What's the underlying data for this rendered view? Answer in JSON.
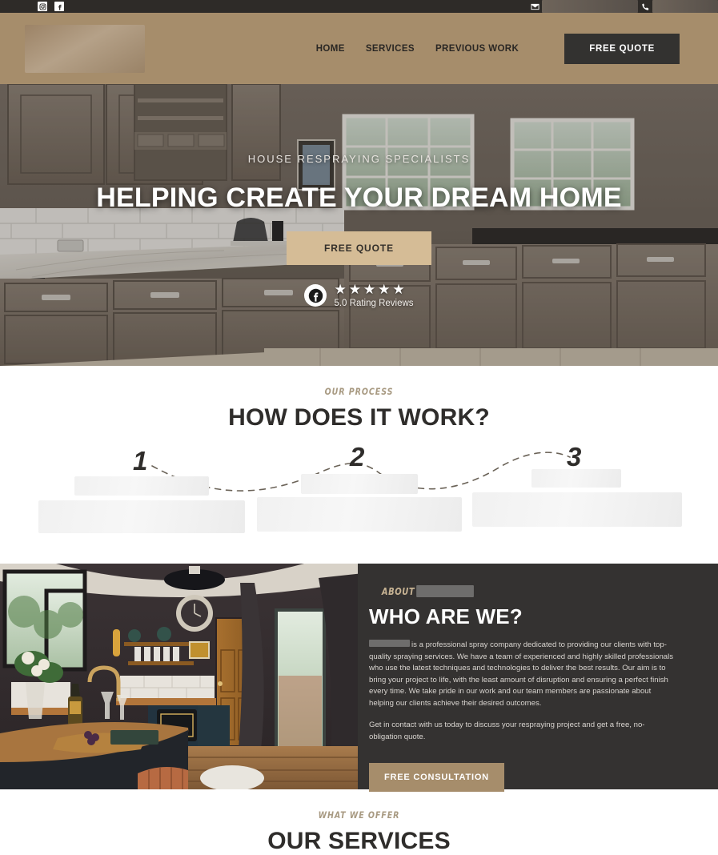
{
  "topbar": {
    "social": [
      {
        "name": "instagram-icon",
        "label": "Instagram"
      },
      {
        "name": "facebook-icon",
        "label": "Facebook"
      }
    ],
    "email_icon": "envelope-icon",
    "email_value": "",
    "phone_icon": "phone-icon",
    "phone_value": "",
    "bg": "#2e2b28"
  },
  "header": {
    "logo_alt": "",
    "nav": [
      {
        "label": "HOME"
      },
      {
        "label": "SERVICES"
      },
      {
        "label": "PREVIOUS WORK"
      }
    ],
    "cta_label": "FREE QUOTE",
    "bg": "#a68d6b",
    "cta_bg": "#333230"
  },
  "hero": {
    "kicker": "HOUSE RESPRAYING SPECIALISTS",
    "title": "HELPING CREATE YOUR DREAM HOME",
    "cta_label": "FREE QUOTE",
    "cta_bg": "#d5bc96",
    "stars": "★★★★★",
    "rating_text": "5.0 Rating Reviews",
    "review_icon": "facebook-icon"
  },
  "process": {
    "eyebrow": "OUR PROCESS",
    "title": "HOW DOES IT WORK?",
    "steps": [
      {
        "number": "1",
        "title": "",
        "body": ""
      },
      {
        "number": "2",
        "title": "",
        "body": ""
      },
      {
        "number": "3",
        "title": "",
        "body": ""
      }
    ]
  },
  "about": {
    "eyebrow": "ABOUT",
    "eyebrow_name": "",
    "title": "WHO ARE WE?",
    "company_name": "",
    "paragraph1": "is a professional spray company dedicated to providing our clients with top-quality spraying services. We have a team of experienced and highly skilled professionals who use the latest techniques and technologies to deliver the best results. Our aim is to bring your project to life, with the least amount of disruption and ensuring a perfect finish every time. We take pride in our work and our team members are passionate about helping our clients achieve their desired outcomes.",
    "paragraph2": "Get in contact with us today to discuss your respraying project and get a free, no-obligation quote.",
    "cta_label": "FREE CONSULTATION",
    "cta_bg": "#a68d6b",
    "bg": "#343231"
  },
  "services": {
    "eyebrow": "WHAT WE OFFER",
    "title": "OUR SERVICES"
  }
}
